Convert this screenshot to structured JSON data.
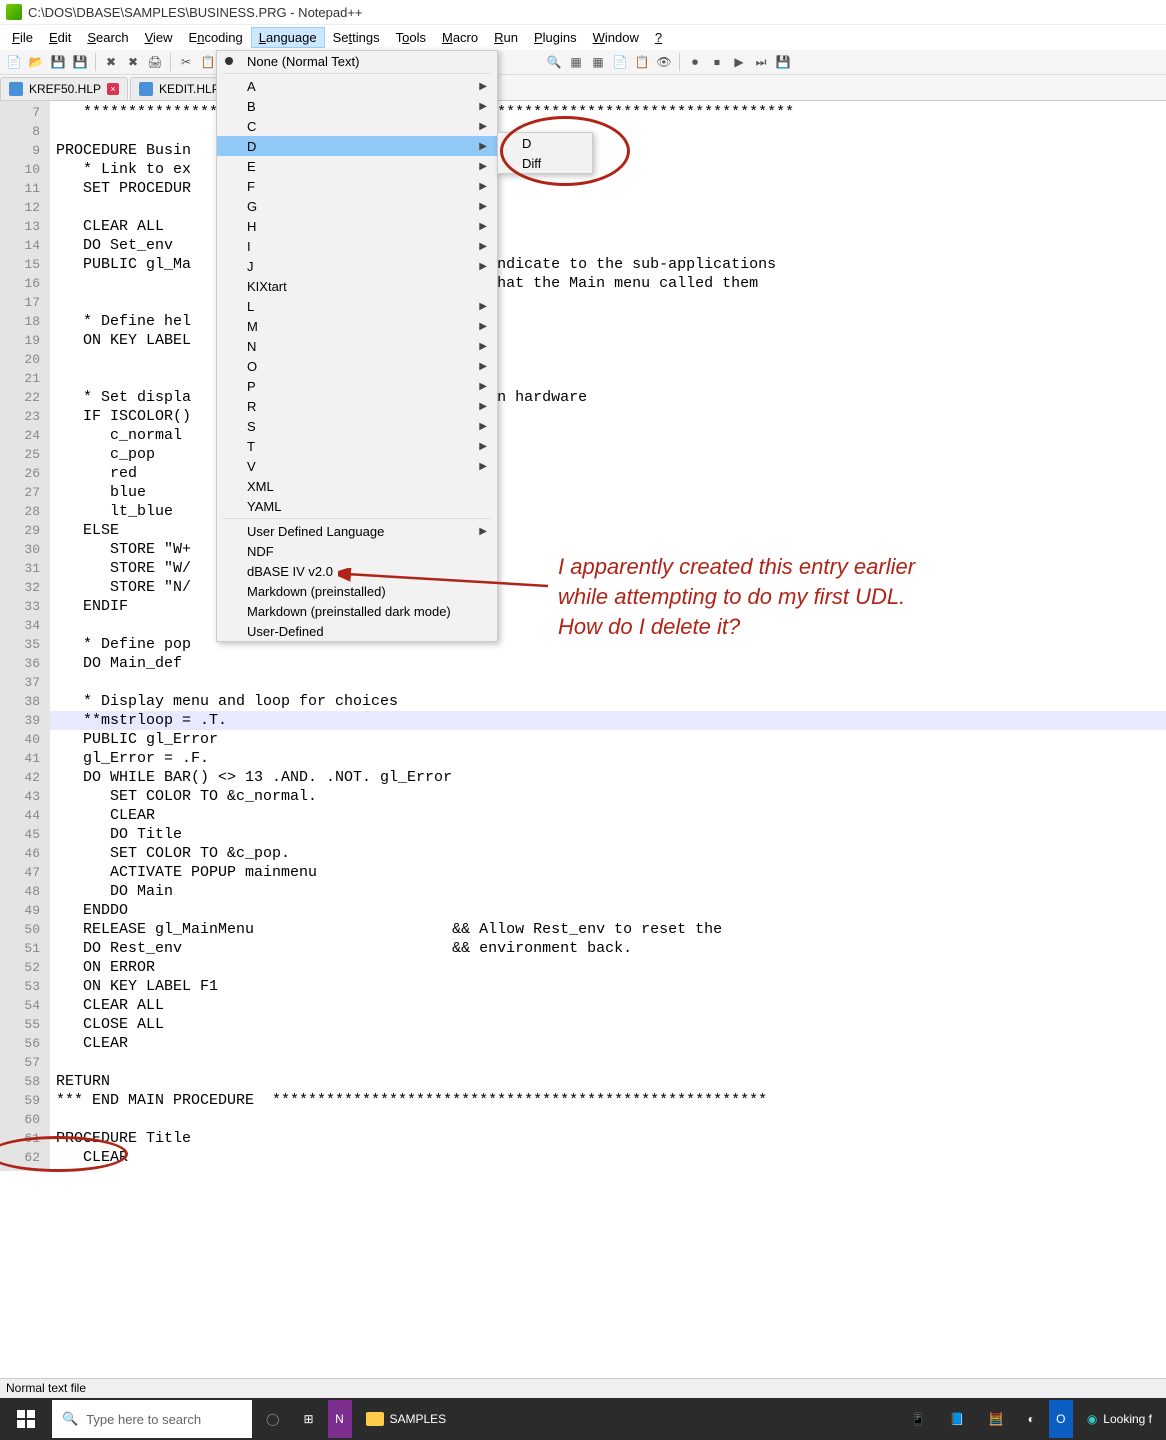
{
  "title": "C:\\DOS\\DBASE\\SAMPLES\\BUSINESS.PRG - Notepad++",
  "menu": {
    "file": "File",
    "edit": "Edit",
    "search": "Search",
    "view": "View",
    "encoding": "Encoding",
    "language": "Language",
    "settings": "Settings",
    "tools": "Tools",
    "macro": "Macro",
    "run": "Run",
    "plugins": "Plugins",
    "window": "Window",
    "help": "?"
  },
  "tabs": {
    "t1": "KREF50.HLP",
    "t2": "KEDIT.HLP"
  },
  "lang_menu": {
    "none": "None (Normal Text)",
    "letters": [
      "A",
      "B",
      "C",
      "D",
      "E",
      "F",
      "G",
      "H",
      "I",
      "J"
    ],
    "kix": "KIXtart",
    "letters2": [
      "L",
      "M",
      "N",
      "O",
      "P",
      "R",
      "S",
      "T",
      "V"
    ],
    "xml": "XML",
    "yaml": "YAML",
    "udl": "User Defined Language",
    "ndf": "NDF",
    "dbase": "dBASE IV v2.0",
    "mdp": "Markdown (preinstalled)",
    "mdpd": "Markdown (preinstalled dark mode)",
    "ud": "User-Defined"
  },
  "sub_menu": {
    "d": "D",
    "diff": "Diff"
  },
  "gutter_start": 7,
  "gutter_end": 62,
  "code": [
    "   **********************************          ***********************************",
    "",
    "PROCEDURE Busin",
    "   * Link to ex                                 dures",
    "   SET PROCEDUR",
    "",
    "   CLEAR ALL",
    "   DO Set_env",
    "   PUBLIC gl_Ma                                 Indicate to the sub-applications",
    "                                                that the Main menu called them",
    "",
    "   * Define hel",
    "   ON KEY LABEL",
    "",
    "",
    "   * Set displa                                 on hardware",
    "   IF ISCOLOR()",
    "      c_normal",
    "      c_pop",
    "      red",
    "      blue",
    "      lt_blue",
    "   ELSE",
    "      STORE \"W+",
    "      STORE \"W/",
    "      STORE \"N/",
    "   ENDIF",
    "",
    "   * Define pop",
    "   DO Main_def",
    "",
    "   * Display menu and loop for choices",
    "   **mstrloop = .T.",
    "   PUBLIC gl_Error",
    "   gl_Error = .F.",
    "   DO WHILE BAR() <> 13 .AND. .NOT. gl_Error",
    "      SET COLOR TO &c_normal.",
    "      CLEAR",
    "      DO Title",
    "      SET COLOR TO &c_pop.",
    "      ACTIVATE POPUP mainmenu",
    "      DO Main",
    "   ENDDO",
    "   RELEASE gl_MainMenu                      && Allow Rest_env to reset the",
    "   DO Rest_env                              && environment back.",
    "   ON ERROR",
    "   ON KEY LABEL F1",
    "   CLEAR ALL",
    "   CLOSE ALL",
    "   CLEAR",
    "",
    "RETURN",
    "*** END MAIN PROCEDURE  *******************************************************",
    "",
    "PROCEDURE Title",
    "   CLEAR"
  ],
  "highlight_line_index": 32,
  "status": "Normal text file",
  "search_placeholder": "Type here to search",
  "task_samples": "SAMPLES",
  "task_looking": "Looking f",
  "annotation": "I apparently created this entry earlier while attempting to do my first UDL. How do I delete it?"
}
